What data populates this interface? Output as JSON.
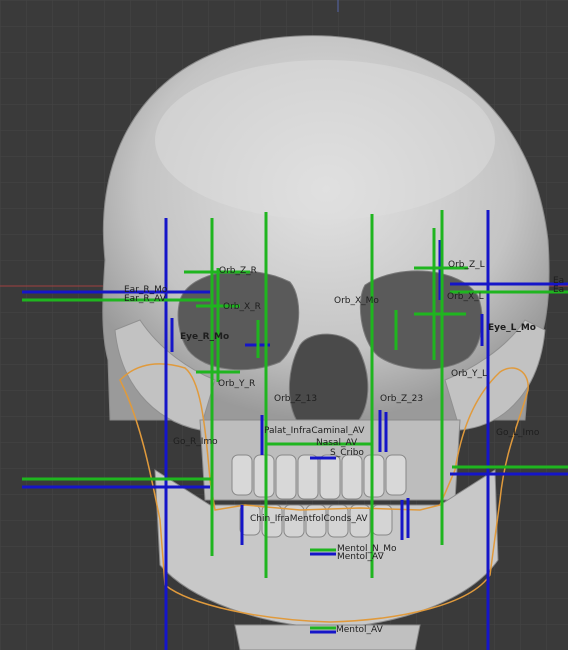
{
  "viewport": {
    "background": "#3a3a3a",
    "grid_color": "#454545",
    "axis_x_color": "#a04040",
    "axis_z_color": "#5566aa",
    "model": "skull-mesh"
  },
  "colors": {
    "green_line": "#1fb51f",
    "blue_line": "#1515c8",
    "outline_orange": "#e09a3c",
    "bone": "#d2d2d2"
  },
  "labels": {
    "ear_r_mo": "Ear_R_Mo",
    "ear_r_av": "Ear_R_AV",
    "ear_l_1": "Ea",
    "ear_l_2": "Ea",
    "orb_z_r": "Orb_Z_R",
    "orb_z_l": "Orb_Z_L",
    "orb_x_r": "Orb_X_R",
    "orb_x_l": "Orb_X_L",
    "orb_x_mo": "Orb_X_Mo",
    "eye_r_mo": "Eye_R_Mo",
    "eye_l_mo": "Eye_L_Mo",
    "orb_y_r": "Orb_Y_R",
    "orb_y_l": "Orb_Y_L",
    "orb_z_13": "Orb_Z_13",
    "orb_z_23": "Orb_Z_23",
    "go_r_mo": "Go_R_Imo",
    "go_l_mo": "Go_L_Imo",
    "palat": "Palat_InfraCaminal_AV",
    "nasal_av": "Nasal_AV",
    "s_crib": "S_Cribo",
    "chin": "Chin_IfraMentfolConds_AV",
    "mentol": "Mentol_N_Mo",
    "ment_av": "Mentol_AV",
    "bottom": "Mentol_AV"
  }
}
